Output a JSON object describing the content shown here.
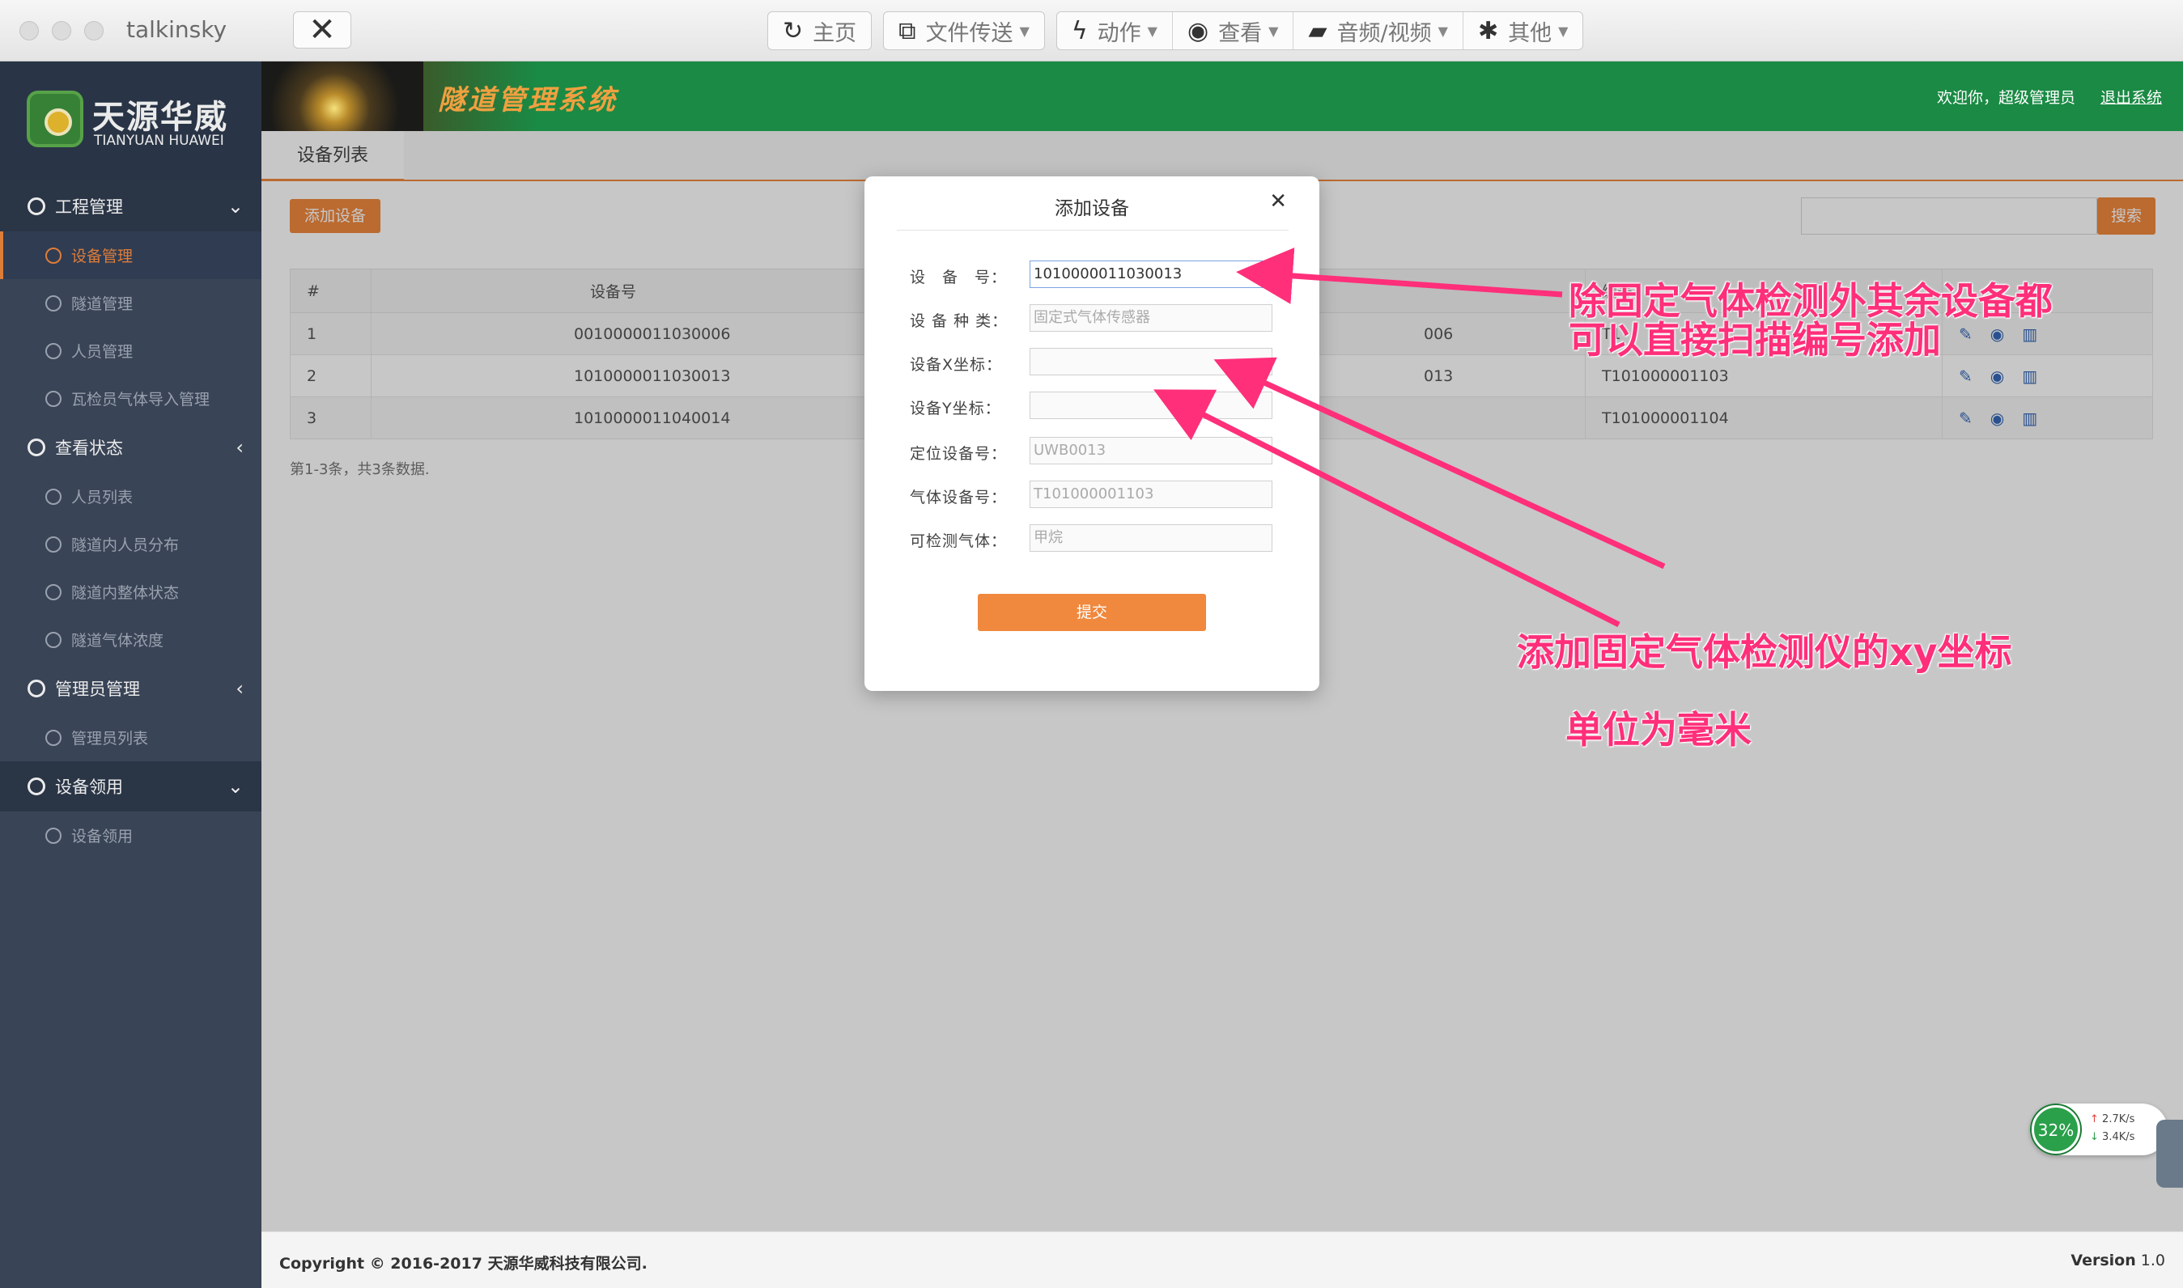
{
  "window": {
    "title": "talkinsky",
    "close_symbol": "✕"
  },
  "toolbar": {
    "home": "主页",
    "file_transfer": "文件传送",
    "action": "动作",
    "view": "查看",
    "av": "音频/视频",
    "other": "其他"
  },
  "brand": {
    "name_cn": "天源华威",
    "name_en": "TIANYUAN HUAWEI"
  },
  "header": {
    "system_title": "隧道管理系统",
    "welcome": "欢迎你，超级管理员",
    "logout": "退出系统"
  },
  "sidebar": {
    "sections": [
      {
        "label": "工程管理",
        "arrow": "⌄",
        "items": [
          "设备管理",
          "隧道管理",
          "人员管理",
          "瓦检员气体导入管理"
        ]
      },
      {
        "label": "查看状态",
        "arrow": "‹",
        "items": [
          "人员列表",
          "隧道内人员分布",
          "隧道内整体状态",
          "隧道气体浓度"
        ]
      },
      {
        "label": "管理员管理",
        "arrow": "‹",
        "items": [
          "管理员列表"
        ]
      },
      {
        "label": "设备领用",
        "arrow": "⌄",
        "items": [
          "设备领用"
        ]
      }
    ]
  },
  "content": {
    "tab": "设备列表",
    "add_button": "添加设备",
    "search_button": "搜索",
    "table": {
      "headers": [
        "#",
        "设备号",
        "",
        "编号"
      ],
      "rows": [
        {
          "num": "1",
          "device": "0010000011030006",
          "left_code": "006",
          "right_code": "T1"
        },
        {
          "num": "2",
          "device": "1010000011030013",
          "left_code": "013",
          "right_code": "T101000001103"
        },
        {
          "num": "3",
          "device": "1010000011040014",
          "left_code": "",
          "right_code": "T101000001104"
        }
      ]
    },
    "summary": "第1-3条，共3条数据."
  },
  "modal": {
    "title": "添加设备",
    "close": "✕",
    "fields": [
      {
        "label": "设　备　号：",
        "value": "1010000011030013",
        "placeholder": ""
      },
      {
        "label": "设 备 种 类：",
        "value": "固定式气体传感器",
        "placeholder": ""
      },
      {
        "label": "设备X坐标：",
        "value": "",
        "placeholder": ""
      },
      {
        "label": "设备Y坐标：",
        "value": "",
        "placeholder": ""
      },
      {
        "label": "定位设备号：",
        "value": "UWB0013",
        "placeholder": ""
      },
      {
        "label": "气体设备号：",
        "value": "T101000001103",
        "placeholder": ""
      },
      {
        "label": "可检测气体：",
        "value": "甲烷",
        "placeholder": ""
      }
    ],
    "submit": "提交"
  },
  "annotations": {
    "note1_line1": "除固定气体检测外其余设备都",
    "note1_line2": "可以直接扫描编号添加",
    "note2": "添加固定气体检测仪的xy坐标",
    "note3": "单位为毫米",
    "color": "#ff2f7a"
  },
  "footer": {
    "copyright": "Copyright © 2016-2017 天源华威科技有限公司.",
    "version_label": "Version",
    "version_value": "1.0"
  },
  "netmon": {
    "percent": "32%",
    "up": "2.7K/s",
    "down": "3.4K/s"
  },
  "colors": {
    "accent": "#f0883e",
    "header_green": "#1a8a44",
    "sidebar": "#3e4a5e"
  }
}
